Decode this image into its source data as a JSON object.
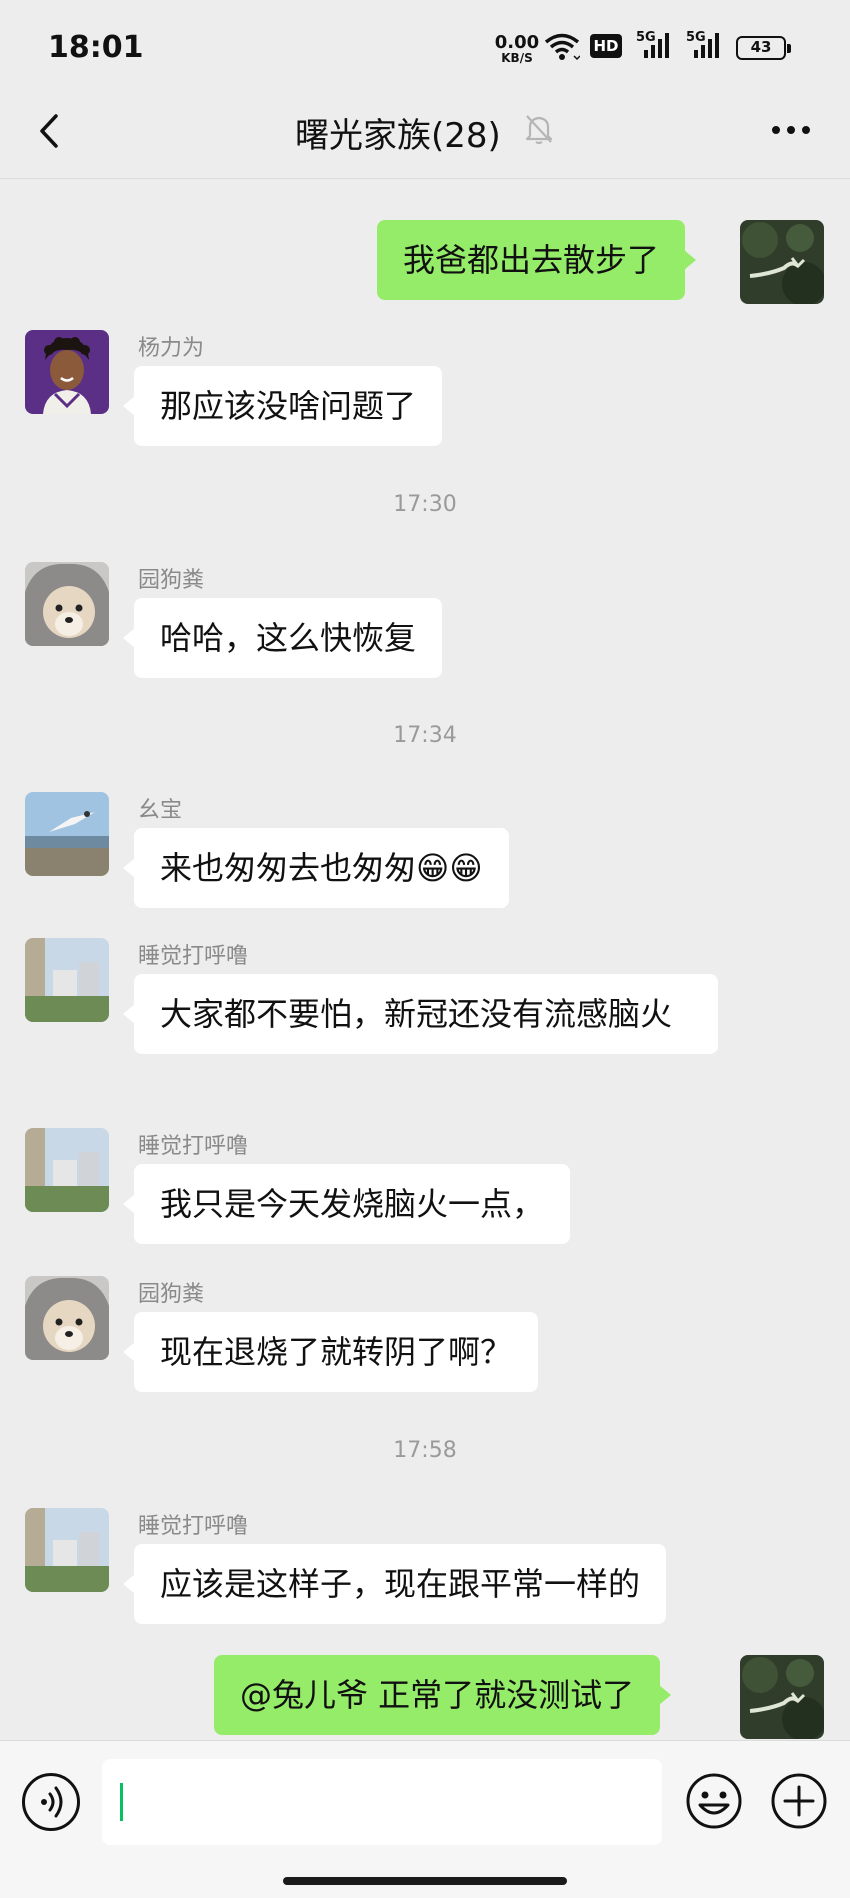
{
  "status_bar": {
    "time": "18:01",
    "net_speed_value": "0.00",
    "net_speed_unit": "KB/S",
    "hd_badge": "HD",
    "signal_1_label": "5G",
    "signal_2_label": "5G",
    "battery": "43",
    "icons": [
      "wifi-icon",
      "hd-voice-icon",
      "signal-icon",
      "signal-icon",
      "battery-icon"
    ]
  },
  "header": {
    "title": "曙光家族(28)",
    "icons": [
      "back-icon",
      "mute-bell-icon",
      "more-icon"
    ]
  },
  "messages": [
    {
      "side": "right",
      "text": "我爸都出去散步了"
    },
    {
      "side": "left",
      "sender": "杨力为",
      "text": "那应该没啥问题了"
    },
    {
      "type": "time",
      "text": "17:30"
    },
    {
      "side": "left",
      "sender": "园狗粪",
      "text": "哈哈，这么快恢复"
    },
    {
      "type": "time",
      "text": "17:34"
    },
    {
      "side": "left",
      "sender": "幺宝",
      "text": "来也匆匆去也匆匆😁😁"
    },
    {
      "side": "left",
      "sender": "睡觉打呼噜",
      "text": "大家都不要怕，新冠还没有流感脑火"
    },
    {
      "side": "left",
      "sender": "睡觉打呼噜",
      "text": "我只是今天发烧脑火一点，"
    },
    {
      "side": "left",
      "sender": "园狗粪",
      "text": "现在退烧了就转阴了啊？"
    },
    {
      "type": "time",
      "text": "17:58"
    },
    {
      "side": "left",
      "sender": "睡觉打呼噜",
      "text": "应该是这样子，现在跟平常一样的"
    },
    {
      "side": "right",
      "text": "@兔儿爷  正常了就没测试了"
    }
  ],
  "input_bar": {
    "value": "",
    "icons": [
      "voice-icon",
      "emoji-icon",
      "plus-icon"
    ]
  },
  "colors": {
    "background": "#ededed",
    "own_bubble": "#95ec69",
    "other_bubble": "#ffffff",
    "cursor": "#07c160"
  }
}
